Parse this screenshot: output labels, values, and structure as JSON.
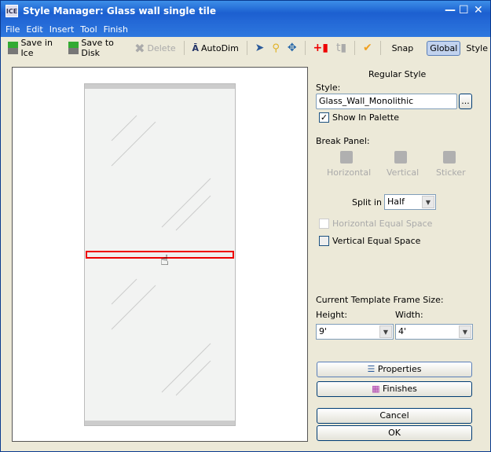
{
  "window": {
    "title": "Style Manager: Glass wall single tile",
    "app_icon": "ICE"
  },
  "menu": [
    "File",
    "Edit",
    "Insert",
    "Tool",
    "Finish"
  ],
  "toolbar": {
    "save_ice": "Save in Ice",
    "save_disk": "Save to Disk",
    "delete": "Delete",
    "autodim": "AutoDim",
    "snap": "Snap",
    "global": "Global",
    "style": "Style"
  },
  "panel": {
    "header": "Regular Style",
    "style_label": "Style:",
    "style_value": "Glass_Wall_Monolithic",
    "browse": "...",
    "show_in_palette": "Show In Palette",
    "show_in_palette_checked": true,
    "break_panel": "Break Panel:",
    "horizontal": "Horizontal",
    "vertical": "Vertical",
    "sticker": "Sticker",
    "split_in": "Split in",
    "split_value": "Half",
    "h_equal": "Horizontal Equal Space",
    "v_equal": "Vertical Equal Space",
    "frame_size": "Current Template Frame Size:",
    "height_label": "Height:",
    "width_label": "Width:",
    "height_value": "9'",
    "width_value": "4'",
    "properties": "Properties",
    "finishes": "Finishes",
    "cancel": "Cancel",
    "ok": "OK"
  },
  "colors": {
    "selection": "#e00000",
    "titlebar": "#1c5fd0"
  }
}
